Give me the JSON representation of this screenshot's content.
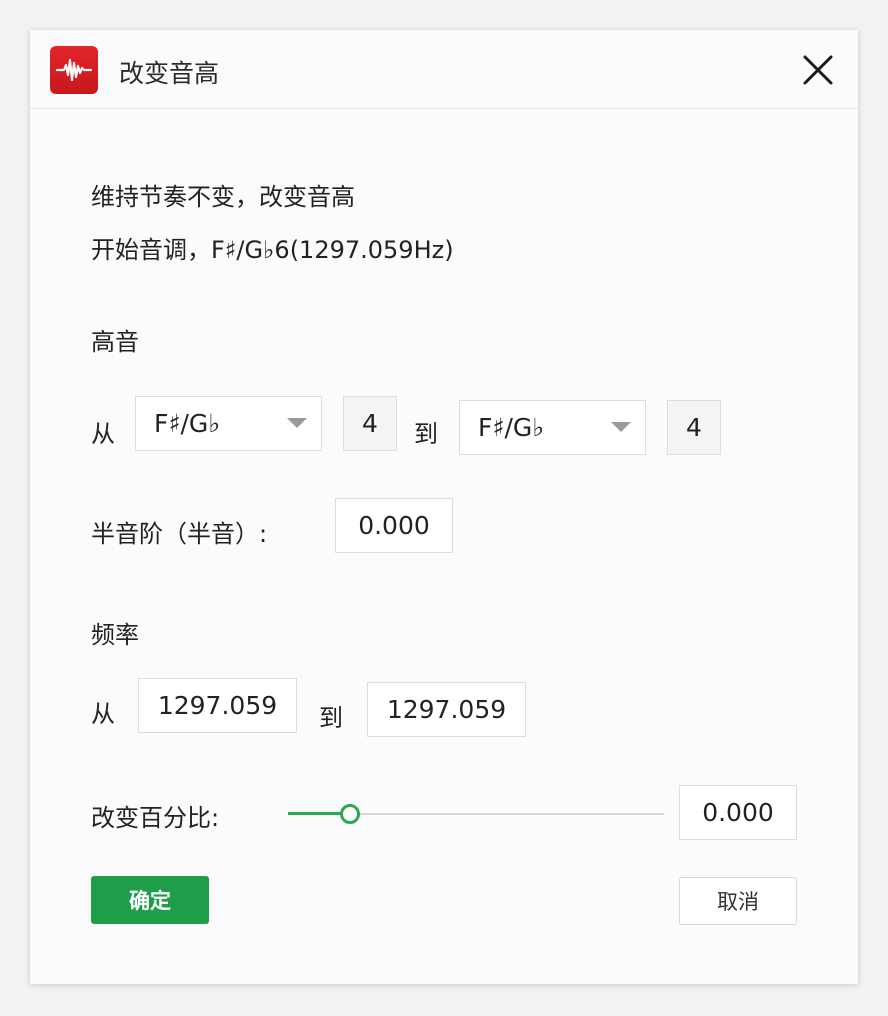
{
  "dialog": {
    "title": "改变音高",
    "icon": "audio-waveform-icon",
    "close_icon": "close-icon"
  },
  "info": {
    "line1": "维持节奏不变，改变音高",
    "line2": "开始音调，F♯/G♭6(1297.059Hz)"
  },
  "pitch": {
    "section_label": "高音",
    "from_label": "从",
    "from_note": "F♯/G♭",
    "from_octave": "4",
    "to_label": "到",
    "to_note": "F♯/G♭",
    "to_octave": "4"
  },
  "semitone": {
    "label": "半音阶（半音）:",
    "value": "0.000"
  },
  "frequency": {
    "section_label": "频率",
    "from_label": "从",
    "from_value": "1297.059",
    "to_label": "到",
    "to_value": "1297.059"
  },
  "percent": {
    "label": "改变百分比:",
    "value": "0.000",
    "slider_fraction": 0.165
  },
  "buttons": {
    "ok": "确定",
    "cancel": "取消"
  },
  "colors": {
    "accent_green": "#1e9e48",
    "icon_red": "#d91e23"
  }
}
